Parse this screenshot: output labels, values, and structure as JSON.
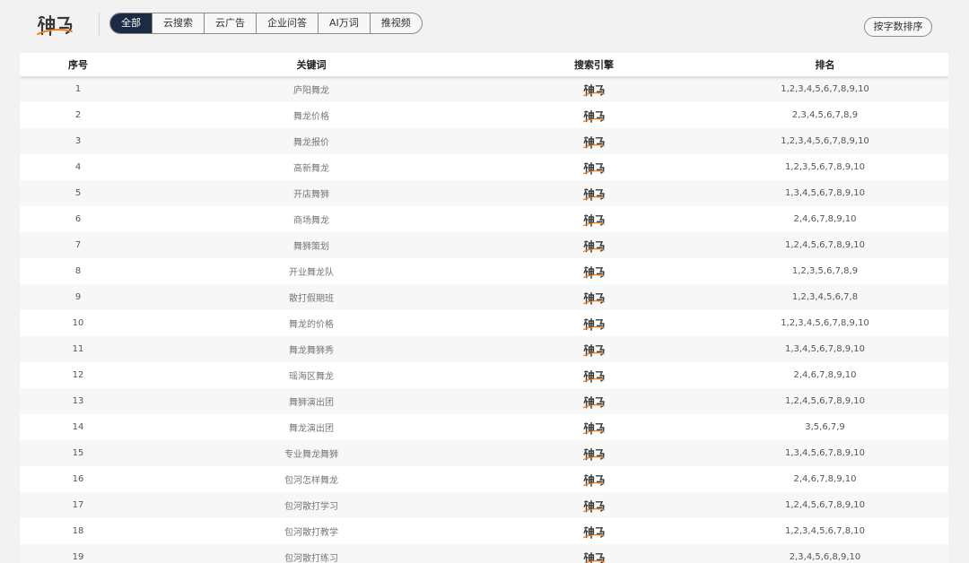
{
  "header": {
    "logo_icon": "shenma-logo",
    "tabs": [
      {
        "label": "全部",
        "active": true
      },
      {
        "label": "云搜索",
        "active": false
      },
      {
        "label": "云广告",
        "active": false
      },
      {
        "label": "企业问答",
        "active": false
      },
      {
        "label": "AI万词",
        "active": false
      },
      {
        "label": "推视频",
        "active": false
      }
    ],
    "sort_button": "按字数排序"
  },
  "table": {
    "columns": [
      "序号",
      "关键词",
      "搜索引擎",
      "排名"
    ],
    "engine_icon": "shenma-logo",
    "rows": [
      {
        "no": "1",
        "keyword": "庐阳舞龙",
        "rank": "1,2,3,4,5,6,7,8,9,10"
      },
      {
        "no": "2",
        "keyword": "舞龙价格",
        "rank": "2,3,4,5,6,7,8,9"
      },
      {
        "no": "3",
        "keyword": "舞龙报价",
        "rank": "1,2,3,4,5,6,7,8,9,10"
      },
      {
        "no": "4",
        "keyword": "高新舞龙",
        "rank": "1,2,3,5,6,7,8,9,10"
      },
      {
        "no": "5",
        "keyword": "开店舞狮",
        "rank": "1,3,4,5,6,7,8,9,10"
      },
      {
        "no": "6",
        "keyword": "商场舞龙",
        "rank": "2,4,6,7,8,9,10"
      },
      {
        "no": "7",
        "keyword": "舞狮策划",
        "rank": "1,2,4,5,6,7,8,9,10"
      },
      {
        "no": "8",
        "keyword": "开业舞龙队",
        "rank": "1,2,3,5,6,7,8,9"
      },
      {
        "no": "9",
        "keyword": "散打假期班",
        "rank": "1,2,3,4,5,6,7,8"
      },
      {
        "no": "10",
        "keyword": "舞龙的价格",
        "rank": "1,2,3,4,5,6,7,8,9,10"
      },
      {
        "no": "11",
        "keyword": "舞龙舞狮秀",
        "rank": "1,3,4,5,6,7,8,9,10"
      },
      {
        "no": "12",
        "keyword": "瑶海区舞龙",
        "rank": "2,4,6,7,8,9,10"
      },
      {
        "no": "13",
        "keyword": "舞狮演出团",
        "rank": "1,2,4,5,6,7,8,9,10"
      },
      {
        "no": "14",
        "keyword": "舞龙演出团",
        "rank": "3,5,6,7,9"
      },
      {
        "no": "15",
        "keyword": "专业舞龙舞狮",
        "rank": "1,3,4,5,6,7,8,9,10"
      },
      {
        "no": "16",
        "keyword": "包河怎样舞龙",
        "rank": "2,4,6,7,8,9,10"
      },
      {
        "no": "17",
        "keyword": "包河散打学习",
        "rank": "1,2,4,5,6,7,8,9,10"
      },
      {
        "no": "18",
        "keyword": "包河散打教学",
        "rank": "1,2,3,4,5,6,7,8,10"
      },
      {
        "no": "19",
        "keyword": "包河散打练习",
        "rank": "2,3,4,5,6,8,9,10"
      }
    ]
  },
  "colors": {
    "active_tab_bg": "#1d2a44",
    "logo_dark": "#3a3a3a",
    "logo_accent": "#e87b1e"
  }
}
